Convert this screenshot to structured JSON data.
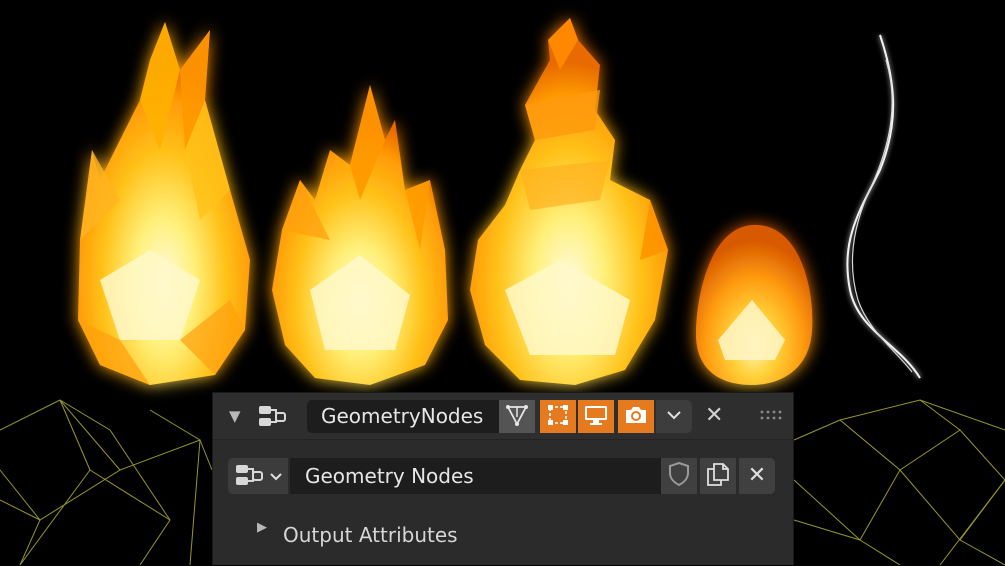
{
  "modifier": {
    "name": "GeometryNodes",
    "toggles": {
      "edit_mode": false,
      "cage": true,
      "viewport": true,
      "render": true
    }
  },
  "node_group": {
    "name": "Geometry Nodes"
  },
  "subpanel": {
    "label": "Output Attributes",
    "expanded": false
  },
  "icons": {
    "collapse": "triangle-down-icon",
    "modifier_type": "geometry-nodes-icon",
    "edit_mode": "edit-mode-icon",
    "cage": "cage-icon",
    "viewport": "monitor-icon",
    "render": "camera-icon",
    "dropdown": "chevron-down-icon",
    "remove": "close-icon",
    "drag": "drag-handle-icon",
    "fake_user": "shield-icon",
    "duplicate": "duplicate-icon",
    "unlink": "close-icon",
    "subpanel": "triangle-right-icon"
  },
  "colors": {
    "accent": "#e57a1f",
    "panel_bg": "#2b2b2b",
    "field_bg": "#1d1d1d"
  }
}
